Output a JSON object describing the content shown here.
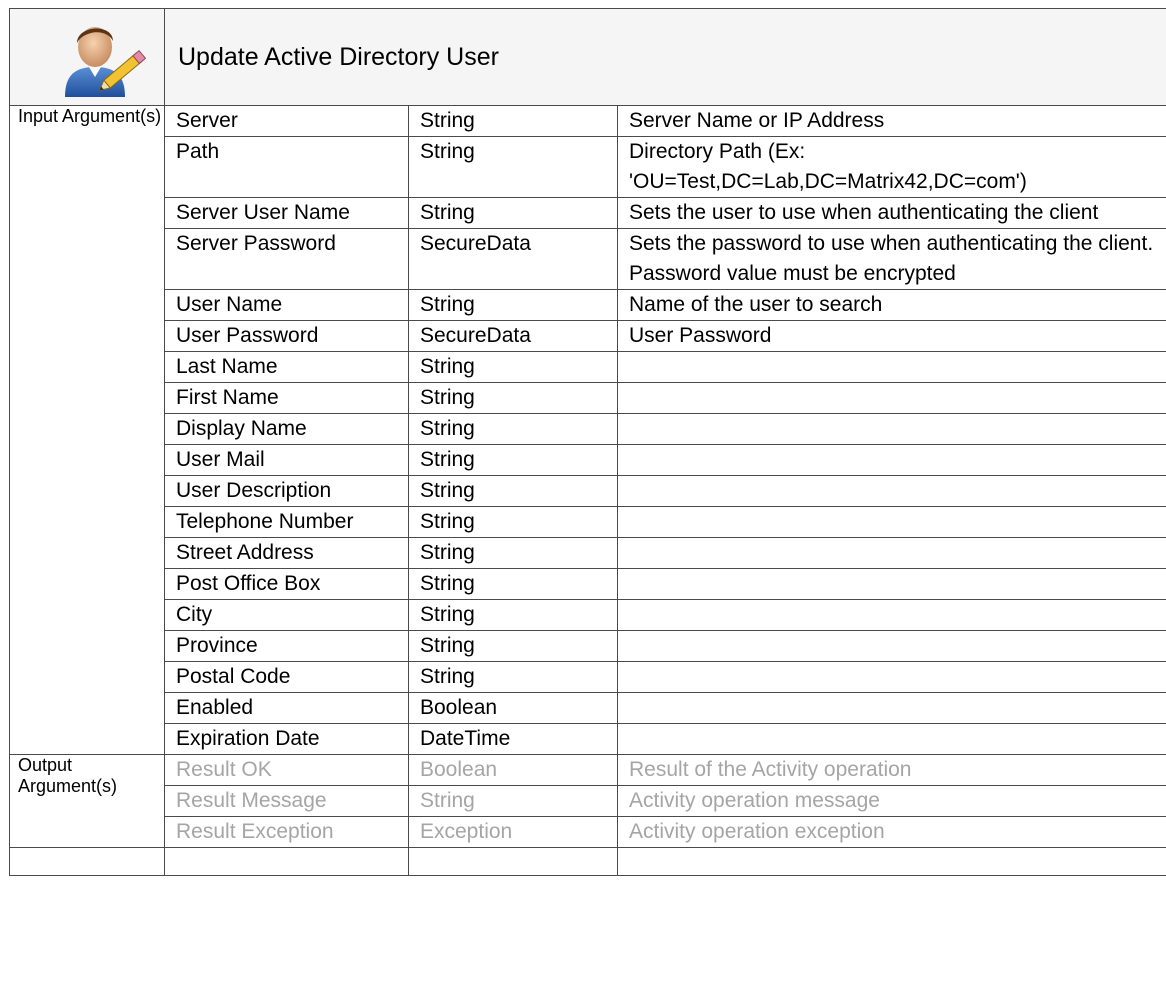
{
  "title": "Update Active Directory User",
  "icon": "user-edit-icon",
  "sections": {
    "input_label": "Input Argument(s)",
    "output_label": "Output Argument(s)"
  },
  "input_arguments": [
    {
      "name": "Server",
      "type": "String",
      "description": "Server Name or IP Address"
    },
    {
      "name": "Path",
      "type": "String",
      "description": "Directory Path (Ex: 'OU=Test,DC=Lab,DC=Matrix42,DC=com')"
    },
    {
      "name": "Server User Name",
      "type": "String",
      "description": "Sets the user to use when authenticating the client"
    },
    {
      "name": "Server Password",
      "type": "SecureData",
      "description": "Sets the password to use when authenticating the client. Password value must be encrypted"
    },
    {
      "name": "User Name",
      "type": "String",
      "description": "Name of the user to search"
    },
    {
      "name": "User Password",
      "type": "SecureData",
      "description": "User Password"
    },
    {
      "name": "Last Name",
      "type": "String",
      "description": ""
    },
    {
      "name": "First Name",
      "type": "String",
      "description": ""
    },
    {
      "name": "Display Name",
      "type": "String",
      "description": ""
    },
    {
      "name": "User Mail",
      "type": "String",
      "description": ""
    },
    {
      "name": "User Description",
      "type": "String",
      "description": ""
    },
    {
      "name": "Telephone Number",
      "type": "String",
      "description": ""
    },
    {
      "name": "Street Address",
      "type": "String",
      "description": ""
    },
    {
      "name": "Post Office Box",
      "type": "String",
      "description": ""
    },
    {
      "name": "City",
      "type": "String",
      "description": ""
    },
    {
      "name": "Province",
      "type": "String",
      "description": ""
    },
    {
      "name": "Postal Code",
      "type": "String",
      "description": ""
    },
    {
      "name": "Enabled",
      "type": "Boolean",
      "description": ""
    },
    {
      "name": "Expiration Date",
      "type": "DateTime",
      "description": ""
    }
  ],
  "output_arguments": [
    {
      "name": "Result OK",
      "type": "Boolean",
      "description": "Result of the Activity operation"
    },
    {
      "name": "Result Message",
      "type": "String",
      "description": "Activity operation message"
    },
    {
      "name": "Result Exception",
      "type": "Exception",
      "description": "Activity operation exception"
    }
  ],
  "colors": {
    "border": "#4a4a4a",
    "header_bg": "#f5f5f5",
    "output_text": "#a5a5a5"
  }
}
